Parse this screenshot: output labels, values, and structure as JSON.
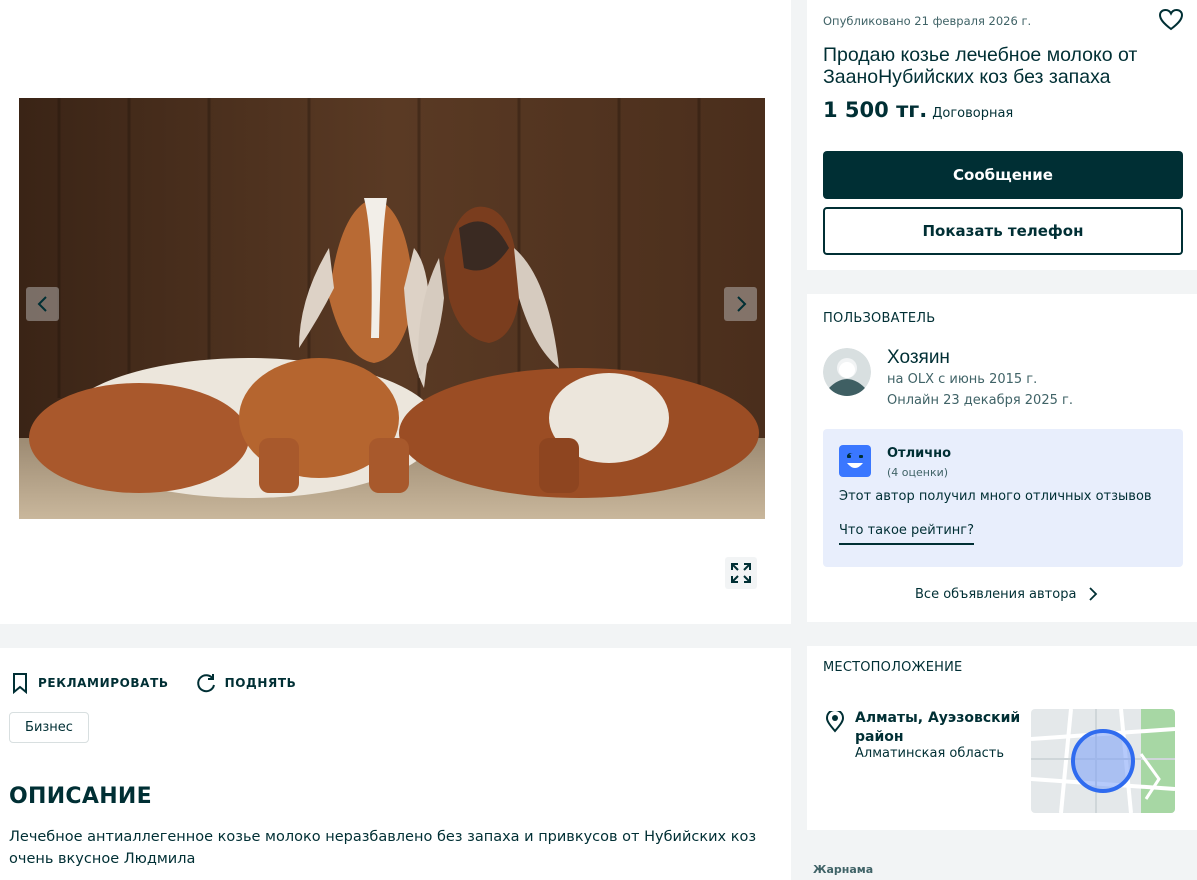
{
  "gallery": {
    "prev_icon": "chevron-left-icon",
    "next_icon": "chevron-right-icon",
    "fullscreen_icon": "expand-icon"
  },
  "listing": {
    "posted": "Опубликовано 21 февраля 2026 г.",
    "title": "Продаю козье лечебное молоко от ЗааноНубийских коз без запаха",
    "price": "1 500 тг.",
    "negotiable": "Договорная",
    "message_button": "Сообщение",
    "phone_button": "Показать телефон"
  },
  "user": {
    "section_title": "ПОЛЬЗОВАТЕЛЬ",
    "name": "Хозяин",
    "since": "на OLX с июнь 2015 г.",
    "online": "Онлайн 23 декабря 2025 г.",
    "rating": {
      "title": "Отлично",
      "count": "(4 оценки)",
      "text": "Этот автор получил много отличных отзывов",
      "link": "Что такое рейтинг?"
    },
    "all_ads": "Все объявления автора"
  },
  "location": {
    "section_title": "МЕСТОПОЛОЖЕНИЕ",
    "city": "Алматы, Ауэзовский район",
    "region": "Алматинская область"
  },
  "actions": {
    "promote": "РЕКЛАМИРОВАТЬ",
    "raise": "ПОДНЯТЬ"
  },
  "tag": "Бизнес",
  "description": {
    "title": "ОПИСАНИЕ",
    "text": "Лечебное антиаллегенное козье молоко неразбавлено без запаха и привкусов от Нубийских коз очень вкусное Людмила"
  },
  "footer": {
    "ad_label": "Жарнама"
  },
  "colors": {
    "primary": "#002f34",
    "rating_bg": "#e8eefc",
    "page_bg": "#f2f4f5"
  }
}
